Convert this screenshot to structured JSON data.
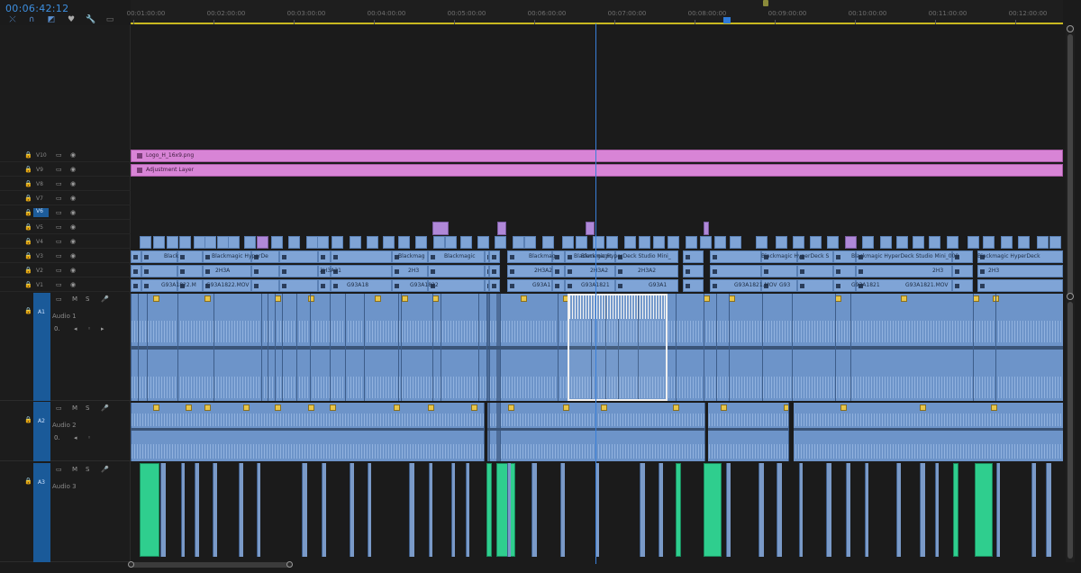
{
  "header": {
    "timecode": "00:06:42:12",
    "tools": [
      "snap-icon",
      "link-icon",
      "marker-add-icon",
      "marker-icon",
      "wrench-icon",
      "captions-icon"
    ]
  },
  "ruler": {
    "labels": [
      "00:01:00:00",
      "00:02:00:00",
      "00:03:00:00",
      "00:04:00:00",
      "00:05:00:00",
      "00:06:00:00",
      "00:07:00:00",
      "00:08:00:00",
      "00:09:00:00",
      "00:10:00:00",
      "00:11:00:00",
      "00:12:00:00"
    ]
  },
  "video_tracks": [
    {
      "name": "V10"
    },
    {
      "name": "V9"
    },
    {
      "name": "V8"
    },
    {
      "name": "V7"
    },
    {
      "name": "V6",
      "selected": true
    },
    {
      "name": "V5"
    },
    {
      "name": "V4"
    },
    {
      "name": "V3"
    },
    {
      "name": "V2"
    },
    {
      "name": "V1"
    }
  ],
  "graphics": {
    "logo_clip": "Logo_H_16x9.png",
    "adjustment_clip": "Adjustment Layer"
  },
  "v3_clips": [
    "Black",
    "Blackmagic HyperDe",
    "Blackmag",
    "Blackmagic",
    "Blackmag",
    "Blackmagic HyperDeck Studio Mini_",
    "Blackmagic",
    "Blackmagic HyperDeck S",
    "Blackmagic HyperDeck Studio Mini_000",
    "Blackmagic HyperDeck"
  ],
  "v2_clips": [
    "2H3A",
    "2H3A21",
    "2H3",
    "2H3A2",
    "2H3A2",
    "2H3A2",
    "2H3",
    "2H3"
  ],
  "v1_clips": [
    "G93A1822.M",
    "G93A1822.MOV",
    "G93A18",
    "G93A1822",
    "G93A1",
    "G93A1821",
    "G93A1",
    "G93A1821.MOV",
    "G93",
    "G93A1821",
    "G93A1821.MOV"
  ],
  "audio_tracks": [
    {
      "id": "A1",
      "name": "Audio 1",
      "mute": "M",
      "solo": "S",
      "volume": "0."
    },
    {
      "id": "A2",
      "name": "Audio 2",
      "mute": "M",
      "solo": "S",
      "volume": "0."
    },
    {
      "id": "A3",
      "name": "Audio 3",
      "mute": "M",
      "solo": "S"
    }
  ],
  "colors": {
    "playhead": "#3a7fd8",
    "graphic_clip": "#d884d6",
    "video_clip": "#7fa4d6",
    "audio_clip": "#6d94c9",
    "music_clip": "#2fce8e",
    "timecode": "#3d8fe0"
  }
}
